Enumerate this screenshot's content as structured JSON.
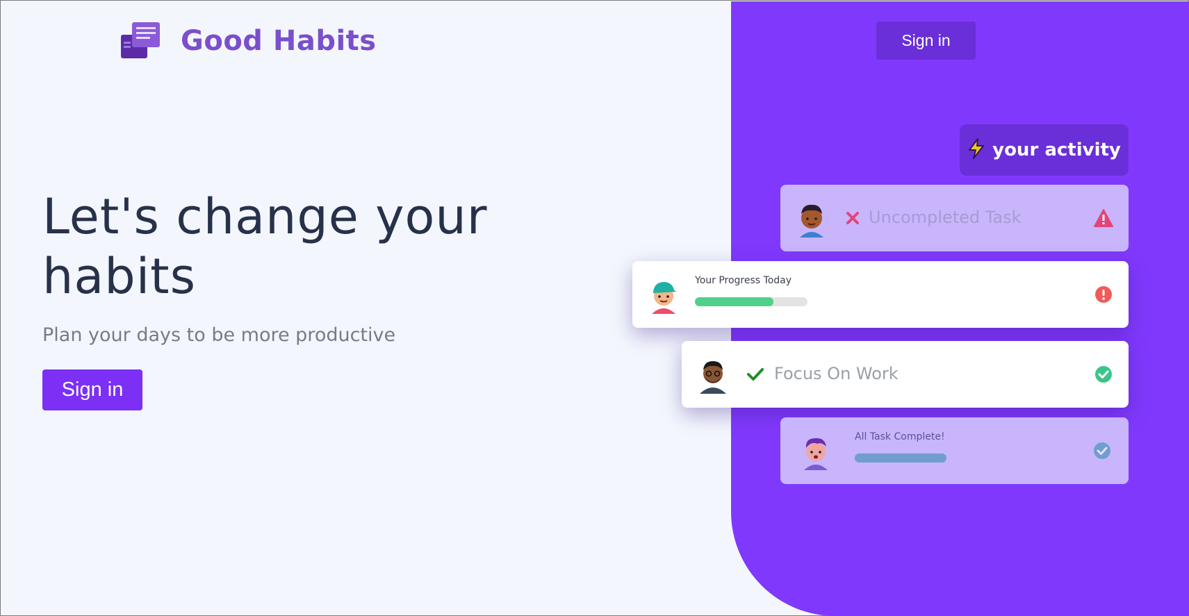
{
  "brand": {
    "name": "Good Habits",
    "logo_icon": "stacked-notes-icon"
  },
  "header": {
    "signin_label": "Sign in"
  },
  "hero": {
    "title": "Let's change your habits",
    "subtitle": "Plan your days to be more productive",
    "signin_label": "Sign in"
  },
  "activity": {
    "label": "your activity",
    "icon": "lightning-bolt-icon"
  },
  "cards": {
    "uncompleted": {
      "title": "Uncompleted Task",
      "mark_icon": "x-icon",
      "status_icon": "warning-triangle-icon"
    },
    "progress": {
      "title": "Your Progress Today",
      "progress": 0.7,
      "status_icon": "alert-circle-icon"
    },
    "focus": {
      "title": "Focus On Work",
      "mark_icon": "checkmark-icon",
      "status_icon": "check-circle-icon"
    },
    "complete": {
      "title": "All Task Complete!",
      "progress": 1.0,
      "status_icon": "check-circle-icon"
    }
  },
  "colors": {
    "accent": "#8039fc",
    "accent_dark": "#6a2fd8",
    "progress_green": "#4fd18b",
    "progress_blue": "#6f9ecf",
    "warning_pink": "#e0457b",
    "alert_red": "#f25a5a",
    "success_green": "#3cc58a"
  }
}
